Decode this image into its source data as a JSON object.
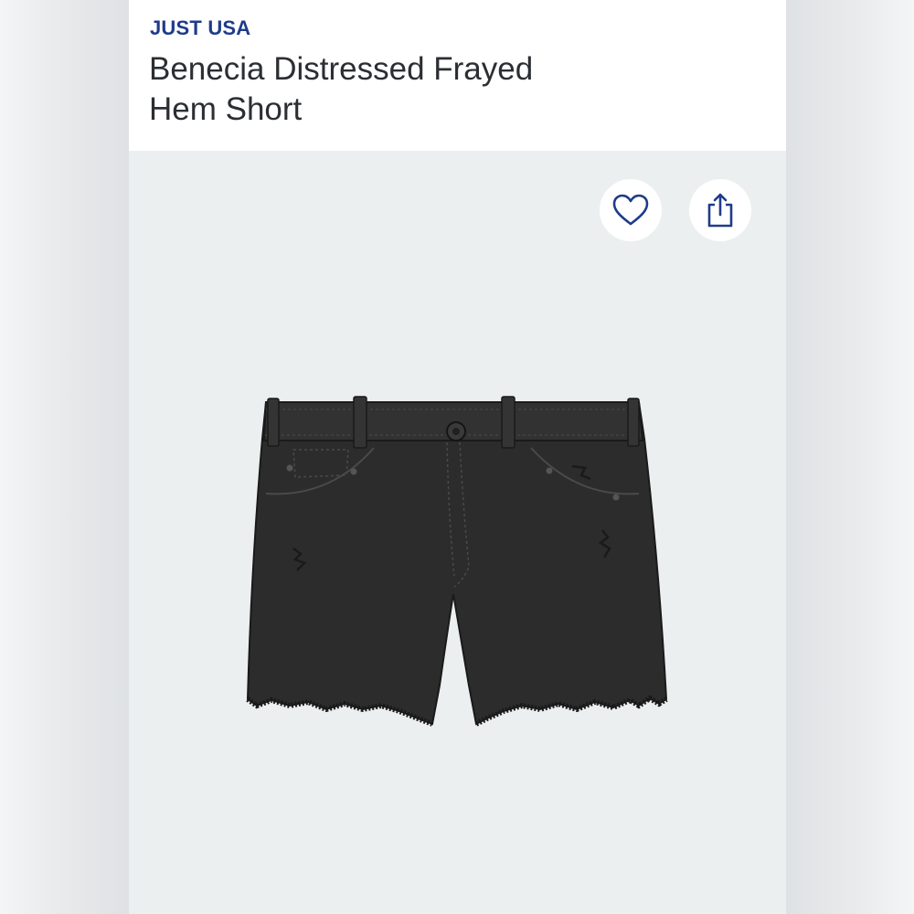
{
  "product": {
    "brand": "JUST USA",
    "title_line1": "Benecia Distressed Frayed",
    "title_line2": "Hem Short"
  },
  "actions": {
    "favorite_icon": "heart-icon",
    "share_icon": "share-icon"
  },
  "colors": {
    "brand": "#1f3b8a",
    "title": "#2b2e33",
    "icon": "#1f3b8a",
    "background": "#eceff0",
    "product": "#2a2a2a"
  }
}
